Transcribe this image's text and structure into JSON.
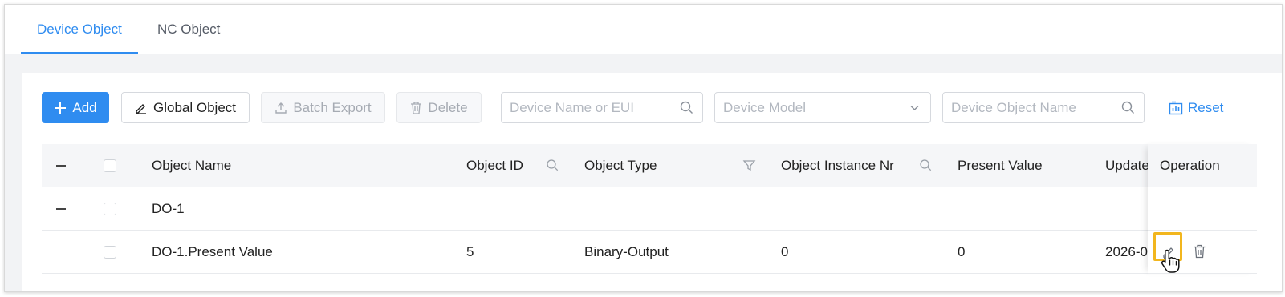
{
  "tabs": [
    {
      "label": "Device Object",
      "active": true
    },
    {
      "label": "NC Object",
      "active": false
    }
  ],
  "toolbar": {
    "add_label": "Add",
    "global_object_label": "Global Object",
    "batch_export_label": "Batch Export",
    "delete_label": "Delete",
    "reset_label": "Reset"
  },
  "filters": {
    "device_name_placeholder": "Device Name or EUI",
    "device_model_placeholder": "Device Model",
    "device_object_name_placeholder": "Device Object Name"
  },
  "table": {
    "columns": {
      "object_name": "Object Name",
      "object_id": "Object ID",
      "object_type": "Object Type",
      "object_instance_nr": "Object Instance Nr",
      "present_value": "Present Value",
      "updated": "Update",
      "operation": "Operation"
    },
    "rows": [
      {
        "object_name": "DO-1",
        "object_id": "",
        "object_type": "",
        "object_instance_nr": "",
        "present_value": "",
        "updated": ""
      },
      {
        "object_name": "DO-1.Present Value",
        "object_id": "5",
        "object_type": "Binary-Output",
        "object_instance_nr": "0",
        "present_value": "0",
        "updated": "2026-0"
      }
    ]
  },
  "icons": {
    "add": "plus-icon",
    "global_object": "edit-icon",
    "batch_export": "upload-icon",
    "delete": "trash-icon",
    "search": "search-icon",
    "dropdown": "chevron-down-icon",
    "reset": "chart-reset-icon",
    "filter": "filter-icon",
    "edit": "edit-icon",
    "row_delete": "trash-icon"
  },
  "colors": {
    "accent": "#2f8cf0",
    "highlight": "#f2b61e"
  }
}
